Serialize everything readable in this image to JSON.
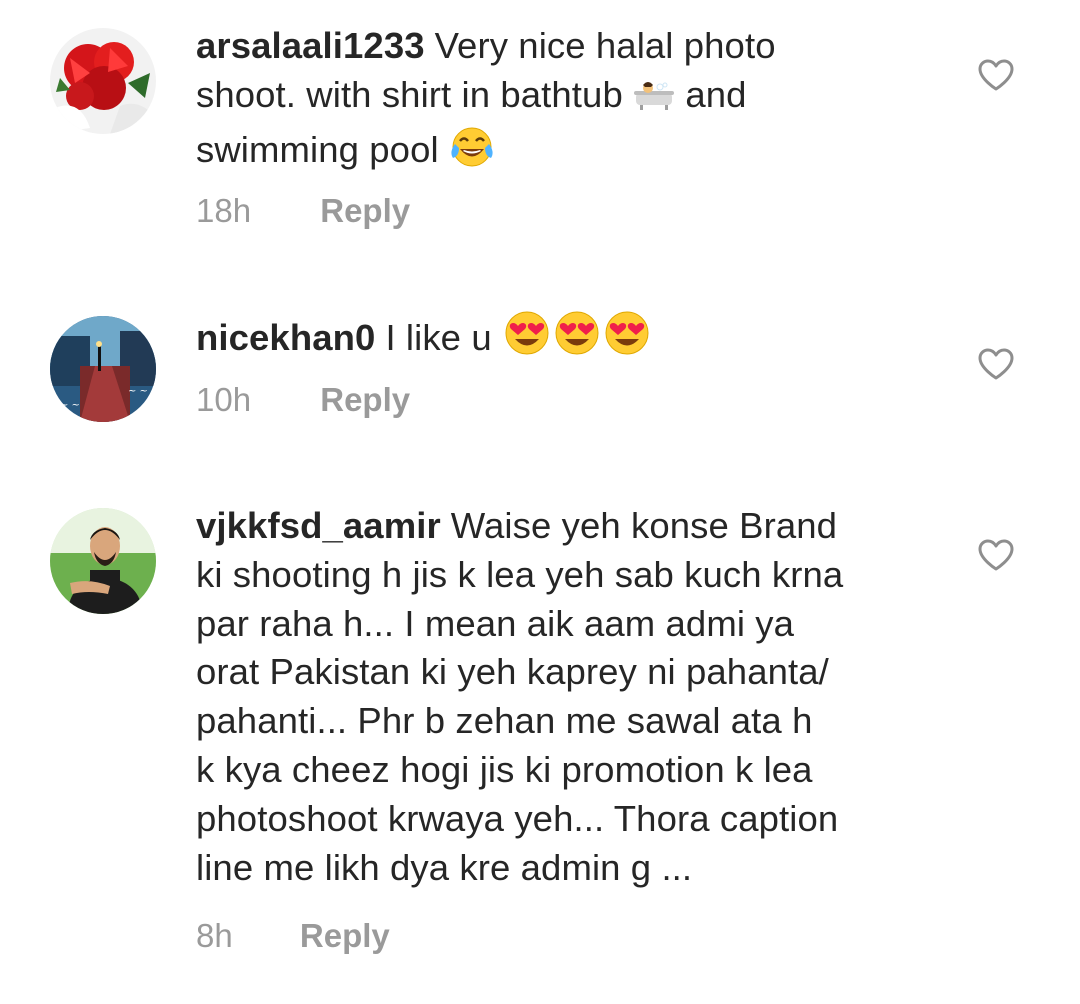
{
  "comments": [
    {
      "username": "arsalaali1233",
      "lines": [
        "Very nice halal photo",
        "shoot. with shirt in bathtub",
        "and",
        "swimming pool"
      ],
      "time": "18h",
      "reply_label": "Reply",
      "emojis": [
        "bathtub-emoji",
        "tears-of-joy-emoji"
      ]
    },
    {
      "username": "nicekhan0",
      "text": "I like u",
      "time": "10h",
      "reply_label": "Reply",
      "emojis": [
        "heart-eyes-emoji",
        "heart-eyes-emoji",
        "heart-eyes-emoji"
      ]
    },
    {
      "username": "vjkkfsd_aamir",
      "lines": [
        "Waise yeh konse Brand",
        "ki shooting h jis k lea yeh sab kuch krna",
        "par raha h... I mean aik aam admi ya",
        "orat Pakistan ki yeh kaprey ni pahanta/",
        "pahanti... Phr b zehan me sawal ata h",
        "k kya cheez hogi jis ki promotion k lea",
        "photoshoot krwaya yeh... Thora caption",
        "line me likh dya kre admin g ..."
      ],
      "time": "8h",
      "reply_label": "Reply"
    }
  ],
  "colors": {
    "text": "#262626",
    "meta": "#9a9a9a",
    "heart_outline": "#8e8e8e"
  },
  "icons": {
    "like": "heart-outline-icon"
  }
}
